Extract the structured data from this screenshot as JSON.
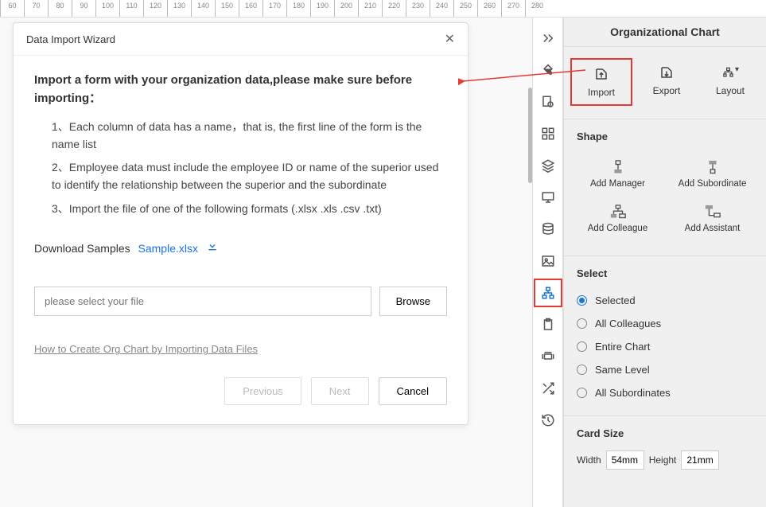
{
  "ruler_start": 60,
  "ruler_step": 10,
  "ruler_count": 23,
  "dialog": {
    "title": "Data Import Wizard",
    "intro": "Import a form with your organization data,please make sure before importing：",
    "steps": [
      "1、Each column of data has a name，that is, the first line of the form is the name list",
      "2、Employee data must include the employee ID or name of the superior used to identify the relationship between the superior and the subordinate",
      "3、Import the file of one of the following formats (.xlsx .xls .csv .txt)"
    ],
    "download_label": "Download Samples",
    "sample_link": "Sample.xlsx",
    "file_placeholder": "please select your file",
    "browse": "Browse",
    "help_link": "How to Create Org Chart by Importing Data Files",
    "previous": "Previous",
    "next": "Next",
    "cancel": "Cancel"
  },
  "rpanel": {
    "title": "Organizational Chart",
    "top_buttons": {
      "import": "Import",
      "export": "Export",
      "layout": "Layout"
    },
    "shape_head": "Shape",
    "shapes": [
      {
        "label": "Add Manager"
      },
      {
        "label": "Add Subordinate"
      },
      {
        "label": "Add Colleague"
      },
      {
        "label": "Add Assistant"
      }
    ],
    "select_head": "Select",
    "select_options": [
      "Selected",
      "All Colleagues",
      "Entire Chart",
      "Same Level",
      "All Subordinates"
    ],
    "select_value": "Selected",
    "cardsize_head": "Card Size",
    "width_label": "Width",
    "height_label": "Height",
    "width_value": "54mm",
    "height_value": "21mm"
  },
  "vtoolbar": [
    "collapse",
    "fill",
    "settings",
    "grid",
    "layers",
    "presentation",
    "data",
    "image",
    "orgchart",
    "clipboard",
    "dimensions",
    "shuffle",
    "history"
  ]
}
